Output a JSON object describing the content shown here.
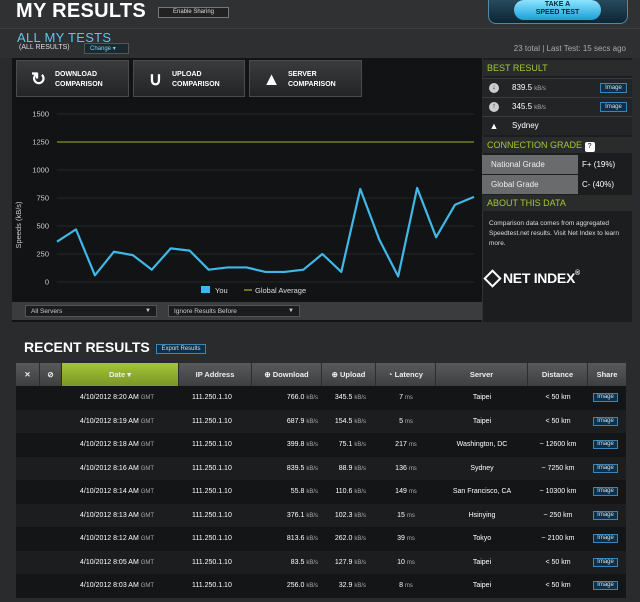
{
  "header": {
    "title": "MY RESULTS",
    "enable_sharing": "Enable Sharing",
    "take_test_line1": "TAKE A",
    "take_test_line2": "SPEED TEST"
  },
  "all_tests": {
    "title": "ALL MY TESTS",
    "subtitle": "(ALL RESULTS)",
    "change_label": "Change",
    "summary": "23 total | Last Test: 15 secs ago"
  },
  "comparison_tabs": [
    {
      "line1": "DOWNLOAD",
      "line2": "COMPARISON",
      "icon": "download-compare-icon"
    },
    {
      "line1": "UPLOAD",
      "line2": "COMPARISON",
      "icon": "upload-compare-icon"
    },
    {
      "line1": "SERVER",
      "line2": "COMPARISON",
      "icon": "server-compare-icon"
    }
  ],
  "chart_data": {
    "type": "line",
    "ylabel": "Speeds (kB/s)",
    "ylim": [
      0,
      1500
    ],
    "yticks": [
      "0",
      "250",
      "500",
      "750",
      "1000",
      "1250",
      "1500"
    ],
    "series": [
      {
        "name": "You",
        "color": "#3fb8e8",
        "values": [
          360,
          470,
          60,
          270,
          240,
          110,
          300,
          280,
          110,
          130,
          130,
          90,
          90,
          110,
          250,
          90,
          830,
          380,
          50,
          840,
          400,
          690,
          760
        ]
      },
      {
        "name": "Global Average",
        "color": "#8b8f2a",
        "values": [
          1250,
          1250
        ]
      }
    ],
    "legend": [
      "You",
      "Global Average"
    ],
    "grid": true
  },
  "filters": {
    "servers": "All Servers",
    "ignore": "Ignore Results Before"
  },
  "best_result": {
    "heading": "BEST RESULT",
    "download": "839.5",
    "upload": "345.5",
    "unit": "kB/s",
    "server": "Sydney",
    "image_label": "Image"
  },
  "connection_grade": {
    "heading": "CONNECTION GRADE",
    "help": "?",
    "national_label": "National Grade",
    "national_value": "F+ (19%)",
    "global_label": "Global Grade",
    "global_value": "C- (40%)"
  },
  "about": {
    "heading": "ABOUT THIS DATA",
    "text": "Comparison data comes from aggregated Speedtest.net results. Visit Net Index to learn more.",
    "logo": "NET INDEX",
    "tm": "®"
  },
  "recent": {
    "title": "RECENT RESULTS",
    "export_label": "Export Results",
    "columns": [
      "Date",
      "IP Address",
      "Download",
      "Upload",
      "Latency",
      "Server",
      "Distance",
      "Share"
    ],
    "rows": [
      {
        "date": "4/10/2012 8:20 AM",
        "tz": "GMT",
        "ip": "111.250.1.10",
        "down": "766.0",
        "up": "345.5",
        "lat": "7",
        "server": "Taipei",
        "dist": "< 50 km"
      },
      {
        "date": "4/10/2012 8:19 AM",
        "tz": "GMT",
        "ip": "111.250.1.10",
        "down": "687.9",
        "up": "154.5",
        "lat": "5",
        "server": "Taipei",
        "dist": "< 50 km"
      },
      {
        "date": "4/10/2012 8:18 AM",
        "tz": "GMT",
        "ip": "111.250.1.10",
        "down": "399.8",
        "up": "75.1",
        "lat": "217",
        "server": "Washington, DC",
        "dist": "~ 12600 km"
      },
      {
        "date": "4/10/2012 8:16 AM",
        "tz": "GMT",
        "ip": "111.250.1.10",
        "down": "839.5",
        "up": "88.9",
        "lat": "136",
        "server": "Sydney",
        "dist": "~ 7250 km"
      },
      {
        "date": "4/10/2012 8:14 AM",
        "tz": "GMT",
        "ip": "111.250.1.10",
        "down": "55.8",
        "up": "110.6",
        "lat": "149",
        "server": "San Francisco, CA",
        "dist": "~ 10300 km"
      },
      {
        "date": "4/10/2012 8:13 AM",
        "tz": "GMT",
        "ip": "111.250.1.10",
        "down": "376.1",
        "up": "102.3",
        "lat": "15",
        "server": "Hsinying",
        "dist": "~ 250 km"
      },
      {
        "date": "4/10/2012 8:12 AM",
        "tz": "GMT",
        "ip": "111.250.1.10",
        "down": "813.6",
        "up": "262.0",
        "lat": "39",
        "server": "Tokyo",
        "dist": "~ 2100 km"
      },
      {
        "date": "4/10/2012 8:05 AM",
        "tz": "GMT",
        "ip": "111.250.1.10",
        "down": "83.5",
        "up": "127.9",
        "lat": "10",
        "server": "Taipei",
        "dist": "< 50 km"
      },
      {
        "date": "4/10/2012 8:03 AM",
        "tz": "GMT",
        "ip": "111.250.1.10",
        "down": "256.0",
        "up": "32.9",
        "lat": "8",
        "server": "Taipei",
        "dist": "< 50 km"
      }
    ],
    "speed_unit": "kB/s",
    "lat_unit": "ms",
    "share_label": "Image"
  }
}
